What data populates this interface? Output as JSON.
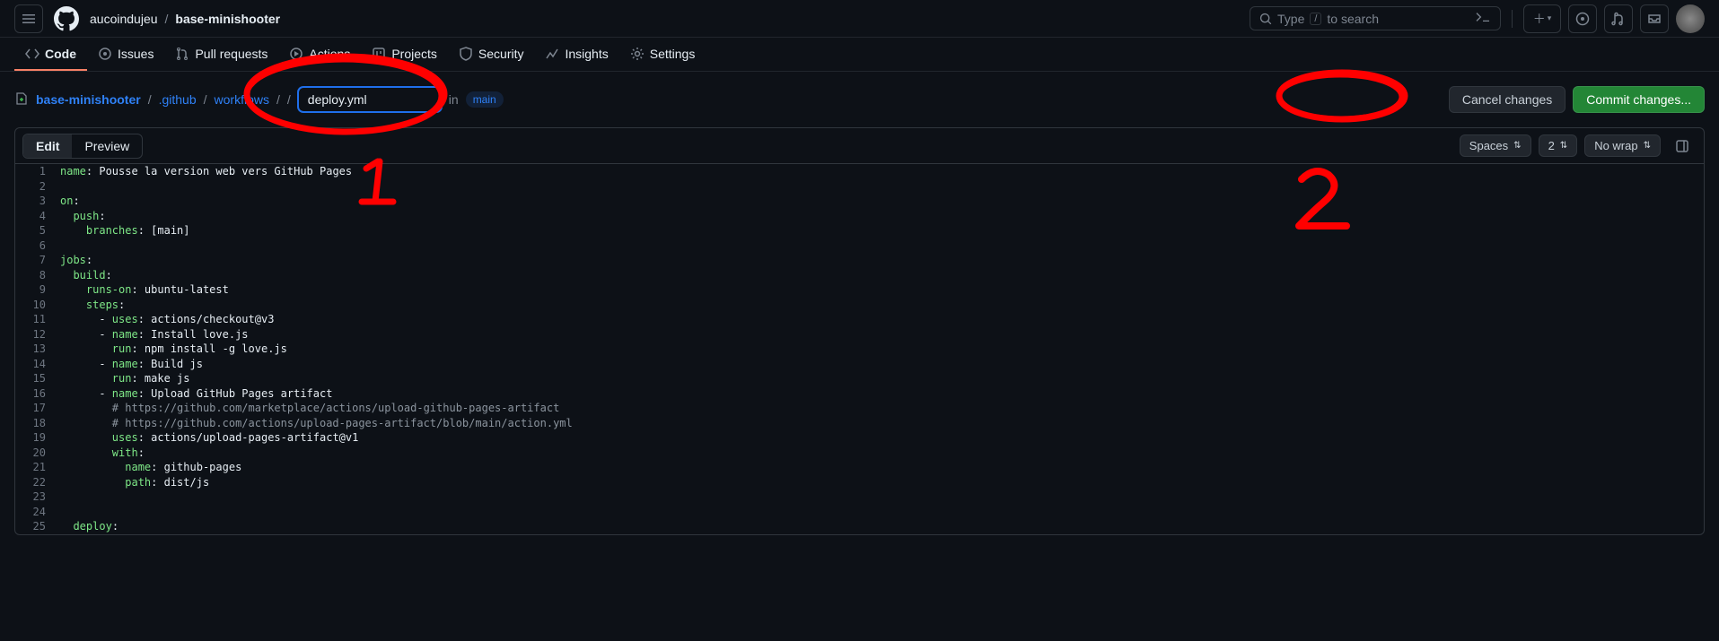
{
  "header": {
    "owner": "aucoindujeu",
    "repo": "base-minishooter",
    "search_placeholder": "Type",
    "search_hint_key": "/",
    "search_hint_rest": "to search"
  },
  "nav": {
    "code": "Code",
    "issues": "Issues",
    "pulls": "Pull requests",
    "actions": "Actions",
    "projects": "Projects",
    "security": "Security",
    "insights": "Insights",
    "settings": "Settings"
  },
  "path": {
    "repo": "base-minishooter",
    "seg1": ".github",
    "seg2": "workflows",
    "filename_value": "deploy.yml",
    "in": "in",
    "branch": "main"
  },
  "buttons": {
    "cancel": "Cancel changes",
    "commit": "Commit changes..."
  },
  "editor_tabs": {
    "edit": "Edit",
    "preview": "Preview"
  },
  "editor_opts": {
    "indent": "Spaces",
    "indent_size": "2",
    "wrap": "No wrap"
  },
  "code_lines": [
    {
      "n": 1,
      "t": [
        [
          "k",
          "name"
        ],
        [
          "p",
          ": "
        ],
        [
          "s",
          "Pousse la version web vers GitHub Pages"
        ]
      ]
    },
    {
      "n": 2,
      "t": []
    },
    {
      "n": 3,
      "t": [
        [
          "k",
          "on"
        ],
        [
          "p",
          ":"
        ]
      ]
    },
    {
      "n": 4,
      "t": [
        [
          "s",
          "  "
        ],
        [
          "k",
          "push"
        ],
        [
          "p",
          ":"
        ]
      ]
    },
    {
      "n": 5,
      "t": [
        [
          "s",
          "    "
        ],
        [
          "k",
          "branches"
        ],
        [
          "p",
          ": [main]"
        ]
      ]
    },
    {
      "n": 6,
      "t": []
    },
    {
      "n": 7,
      "t": [
        [
          "k",
          "jobs"
        ],
        [
          "p",
          ":"
        ]
      ]
    },
    {
      "n": 8,
      "t": [
        [
          "s",
          "  "
        ],
        [
          "k",
          "build"
        ],
        [
          "p",
          ":"
        ]
      ]
    },
    {
      "n": 9,
      "t": [
        [
          "s",
          "    "
        ],
        [
          "k",
          "runs-on"
        ],
        [
          "p",
          ": ubuntu-latest"
        ]
      ]
    },
    {
      "n": 10,
      "t": [
        [
          "s",
          "    "
        ],
        [
          "k",
          "steps"
        ],
        [
          "p",
          ":"
        ]
      ]
    },
    {
      "n": 11,
      "t": [
        [
          "s",
          "      - "
        ],
        [
          "k",
          "uses"
        ],
        [
          "p",
          ": actions/checkout@v3"
        ]
      ]
    },
    {
      "n": 12,
      "t": [
        [
          "s",
          "      - "
        ],
        [
          "k",
          "name"
        ],
        [
          "p",
          ": Install love.js"
        ]
      ]
    },
    {
      "n": 13,
      "t": [
        [
          "s",
          "        "
        ],
        [
          "k",
          "run"
        ],
        [
          "p",
          ": npm install -g love.js"
        ]
      ]
    },
    {
      "n": 14,
      "t": [
        [
          "s",
          "      - "
        ],
        [
          "k",
          "name"
        ],
        [
          "p",
          ": Build js"
        ]
      ]
    },
    {
      "n": 15,
      "t": [
        [
          "s",
          "        "
        ],
        [
          "k",
          "run"
        ],
        [
          "p",
          ": make js"
        ]
      ]
    },
    {
      "n": 16,
      "t": [
        [
          "s",
          "      - "
        ],
        [
          "k",
          "name"
        ],
        [
          "p",
          ": Upload GitHub Pages artifact"
        ]
      ]
    },
    {
      "n": 17,
      "t": [
        [
          "s",
          "        "
        ],
        [
          "c",
          "# https://github.com/marketplace/actions/upload-github-pages-artifact"
        ]
      ]
    },
    {
      "n": 18,
      "t": [
        [
          "s",
          "        "
        ],
        [
          "c",
          "# https://github.com/actions/upload-pages-artifact/blob/main/action.yml"
        ]
      ]
    },
    {
      "n": 19,
      "t": [
        [
          "s",
          "        "
        ],
        [
          "k",
          "uses"
        ],
        [
          "p",
          ": actions/upload-pages-artifact@v1"
        ]
      ]
    },
    {
      "n": 20,
      "t": [
        [
          "s",
          "        "
        ],
        [
          "k",
          "with"
        ],
        [
          "p",
          ":"
        ]
      ]
    },
    {
      "n": 21,
      "t": [
        [
          "s",
          "          "
        ],
        [
          "k",
          "name"
        ],
        [
          "p",
          ": github-pages"
        ]
      ]
    },
    {
      "n": 22,
      "t": [
        [
          "s",
          "          "
        ],
        [
          "k",
          "path"
        ],
        [
          "p",
          ": dist/js"
        ]
      ]
    },
    {
      "n": 23,
      "t": []
    },
    {
      "n": 24,
      "t": []
    },
    {
      "n": 25,
      "t": [
        [
          "s",
          "  "
        ],
        [
          "k",
          "deploy"
        ],
        [
          "p",
          ":"
        ]
      ]
    }
  ],
  "annotations": {
    "label1": "1",
    "label2": "2"
  }
}
